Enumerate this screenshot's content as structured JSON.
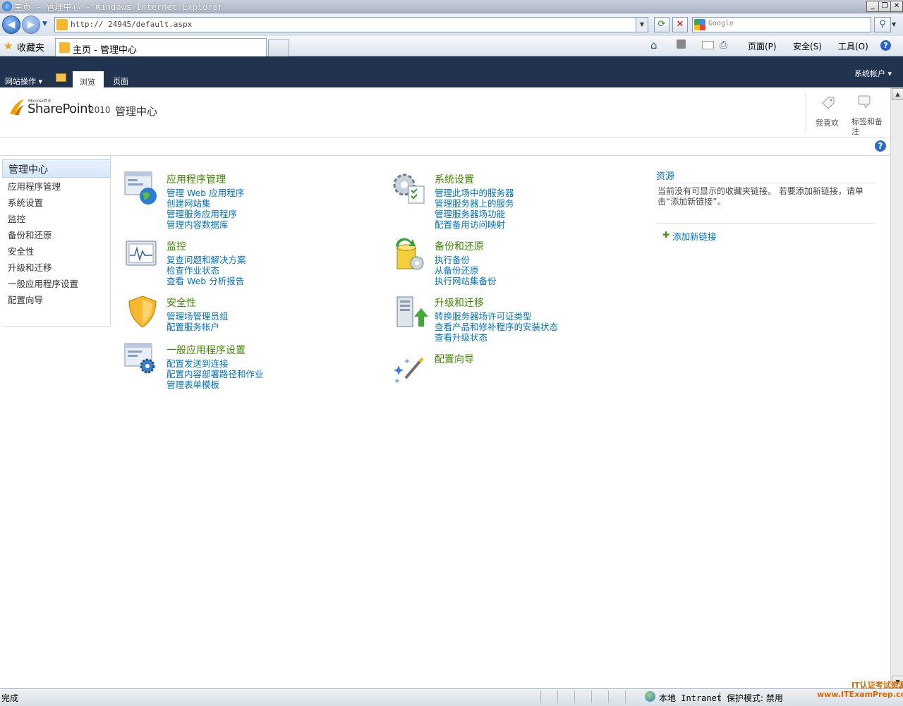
{
  "browser": {
    "window_title": "主页 - 管理中心 - Windows Internet Explorer",
    "address": "http://            24945/default.aspx",
    "search_placeholder": "Google",
    "favorites_label": "收藏夹",
    "tab_title": "主页 - 管理中心",
    "menu": {
      "page": "页面(P)",
      "safety": "安全(S)",
      "tools": "工具(O)"
    },
    "status": {
      "text": "完成",
      "zone": "本地 Intranet",
      "protected_mode": "保护模式: 禁用"
    },
    "watermark": [
      "IT认证考试资源网",
      "www.ITExamPrep.com"
    ]
  },
  "ribbon": {
    "site_actions": "网站操作",
    "tabs": [
      "浏览",
      "页面"
    ],
    "account": "系统帐户"
  },
  "header": {
    "brand_small": "Microsoft®",
    "brand": "SharePoint",
    "brand_year": "2010",
    "site_title": "管理中心",
    "social": [
      "我喜欢",
      "标签和备注"
    ]
  },
  "leftnav": {
    "selected": "管理中心",
    "items": [
      "应用程序管理",
      "系统设置",
      "监控",
      "备份和还原",
      "安全性",
      "升级和迁移",
      "一般应用程序设置",
      "配置向导"
    ]
  },
  "sections": [
    {
      "icon": "app-management-icon",
      "title": "应用程序管理",
      "links": [
        "管理 Web 应用程序",
        "创建网站集",
        "管理服务应用程序",
        "管理内容数据库"
      ]
    },
    {
      "icon": "monitoring-icon",
      "title": "监控",
      "links": [
        "复查问题和解决方案",
        "检查作业状态",
        "查看 Web 分析报告"
      ]
    },
    {
      "icon": "security-shield-icon",
      "title": "安全性",
      "links": [
        "管理场管理员组",
        "配置服务帐户"
      ]
    },
    {
      "icon": "general-settings-icon",
      "title": "一般应用程序设置",
      "links": [
        "配置发送到连接",
        "配置内容部署路径和作业",
        "管理表单模板"
      ]
    },
    {
      "icon": "system-settings-icon",
      "title": "系统设置",
      "links": [
        "管理此场中的服务器",
        "管理服务器上的服务",
        "管理服务器场功能",
        "配置备用访问映射"
      ]
    },
    {
      "icon": "backup-restore-icon",
      "title": "备份和还原",
      "links": [
        "执行备份",
        "从备份还原",
        "执行网站集备份"
      ]
    },
    {
      "icon": "upgrade-migration-icon",
      "title": "升级和迁移",
      "links": [
        "转换服务器场许可证类型",
        "查看产品和修补程序的安装状态",
        "查看升级状态"
      ]
    },
    {
      "icon": "config-wizard-icon",
      "title": "配置向导",
      "links": []
    }
  ],
  "resources": {
    "title": "资源",
    "empty_text": "当前没有可显示的收藏夹链接。 若要添加新链接，请单击“添加新链接”。",
    "add_link": "添加新链接"
  }
}
